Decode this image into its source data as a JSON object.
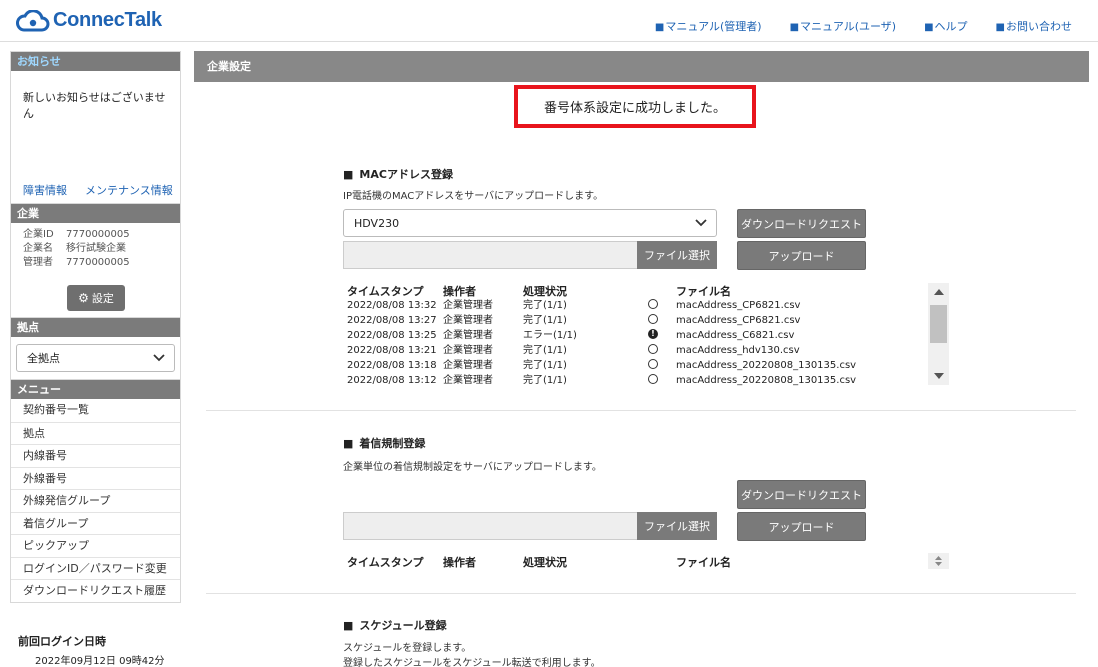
{
  "header": {
    "logo_text": "ConnecTalk",
    "links": [
      "マニュアル(管理者)",
      "マニュアル(ユーザ)",
      "ヘルプ",
      "お問い合わせ"
    ]
  },
  "sidebar": {
    "notice": {
      "title": "お知らせ",
      "body": "新しいお知らせはございません",
      "links": [
        "障害情報",
        "メンテナンス情報"
      ]
    },
    "company": {
      "title": "企業",
      "rows": [
        {
          "k": "企業ID",
          "v": "7770000005"
        },
        {
          "k": "企業名",
          "v": "移行試験企業"
        },
        {
          "k": "管理者",
          "v": "7770000005"
        }
      ],
      "settings_label": "設定"
    },
    "site": {
      "title": "拠点",
      "selected": "全拠点"
    },
    "menu": {
      "title": "メニュー",
      "items": [
        "契約番号一覧",
        "拠点",
        "内線番号",
        "外線番号",
        "外線発信グループ",
        "着信グループ",
        "ピックアップ",
        "ログインID／パスワード変更",
        "ダウンロードリクエスト履歴"
      ]
    },
    "last_login": {
      "title": "前回ログイン日時",
      "value": "2022年09月12日  09時42分"
    }
  },
  "main": {
    "title": "企業設定",
    "success_message": "番号体系設定に成功しました。",
    "mac": {
      "heading": "MACアドレス登録",
      "description": "IP電話機のMACアドレスをサーバにアップロードします。",
      "model_selected": "HDV230",
      "file_button": "ファイル選択",
      "download_button": "ダウンロードリクエスト",
      "upload_button": "アップロード",
      "headers": [
        "タイムスタンプ",
        "操作者",
        "処理状況",
        "ファイル名"
      ],
      "rows": [
        {
          "ts": "2022/08/08 13:32",
          "op": "企業管理者",
          "status": "完了(1/1)",
          "icon": "check-circle-icon",
          "file": "macAddress_CP6821.csv"
        },
        {
          "ts": "2022/08/08 13:27",
          "op": "企業管理者",
          "status": "完了(1/1)",
          "icon": "check-circle-icon",
          "file": "macAddress_CP6821.csv"
        },
        {
          "ts": "2022/08/08 13:25",
          "op": "企業管理者",
          "status": "エラー(1/1)",
          "icon": "error-icon",
          "file": "macAddress_C6821.csv"
        },
        {
          "ts": "2022/08/08 13:21",
          "op": "企業管理者",
          "status": "完了(1/1)",
          "icon": "check-circle-icon",
          "file": "macAddress_hdv130.csv"
        },
        {
          "ts": "2022/08/08 13:18",
          "op": "企業管理者",
          "status": "完了(1/1)",
          "icon": "check-circle-icon",
          "file": "macAddress_20220808_130135.csv"
        },
        {
          "ts": "2022/08/08 13:12",
          "op": "企業管理者",
          "status": "完了(1/1)",
          "icon": "check-circle-icon",
          "file": "macAddress_20220808_130135.csv"
        }
      ]
    },
    "incoming": {
      "heading": "着信規制登録",
      "description": "企業単位の着信規制設定をサーバにアップロードします。",
      "file_button": "ファイル選択",
      "download_button": "ダウンロードリクエスト",
      "upload_button": "アップロード",
      "headers": [
        "タイムスタンプ",
        "操作者",
        "処理状況",
        "ファイル名"
      ]
    },
    "schedule": {
      "heading": "スケジュール登録",
      "description1": "スケジュールを登録します。",
      "description2": "登録したスケジュールをスケジュール転送で利用します。"
    }
  }
}
